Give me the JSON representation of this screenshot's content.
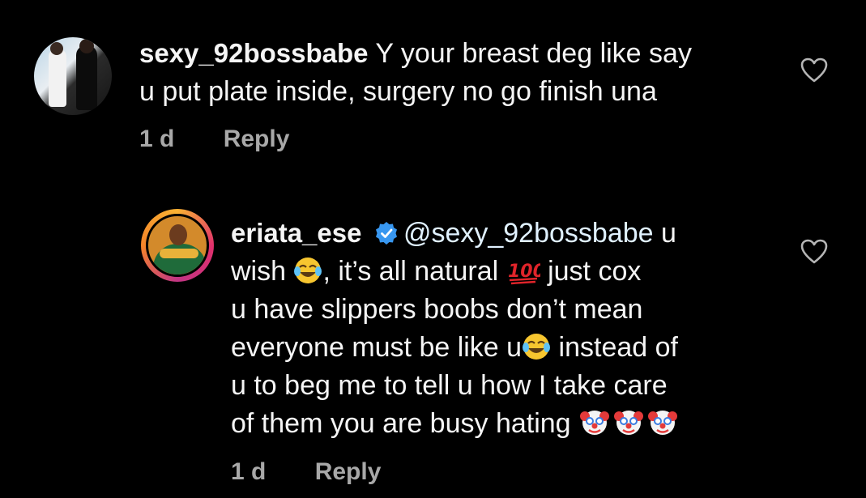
{
  "comments": [
    {
      "username": "sexy_92bossbabe",
      "line1": "Y your breast deg like say",
      "line2": "u put plate inside, surgery no go finish una",
      "time": "1 d",
      "reply_label": "Reply"
    },
    {
      "username": "eriata_ese",
      "mention": "@sexy_92bossbabe",
      "line1_tail": "u",
      "line2_a": "wish",
      "line2_b": ", it’s all natural",
      "line2_c": "just cox",
      "line3": "u have slippers boobs don’t mean",
      "line4_a": "everyone must be like u",
      "line4_b": "instead of",
      "line5": "u to beg me to tell u how I take care",
      "line6": "of them you are busy hating",
      "time": "1 d",
      "reply_label": "Reply"
    }
  ],
  "colors": {
    "background": "#000000",
    "text": "#f5f5f5",
    "meta": "#a8a8a8",
    "verified": "#3897f0"
  },
  "icons": [
    "heart-icon",
    "verified-badge-icon",
    "joy-emoji-icon",
    "hundred-emoji-icon",
    "clown-emoji-icon"
  ]
}
